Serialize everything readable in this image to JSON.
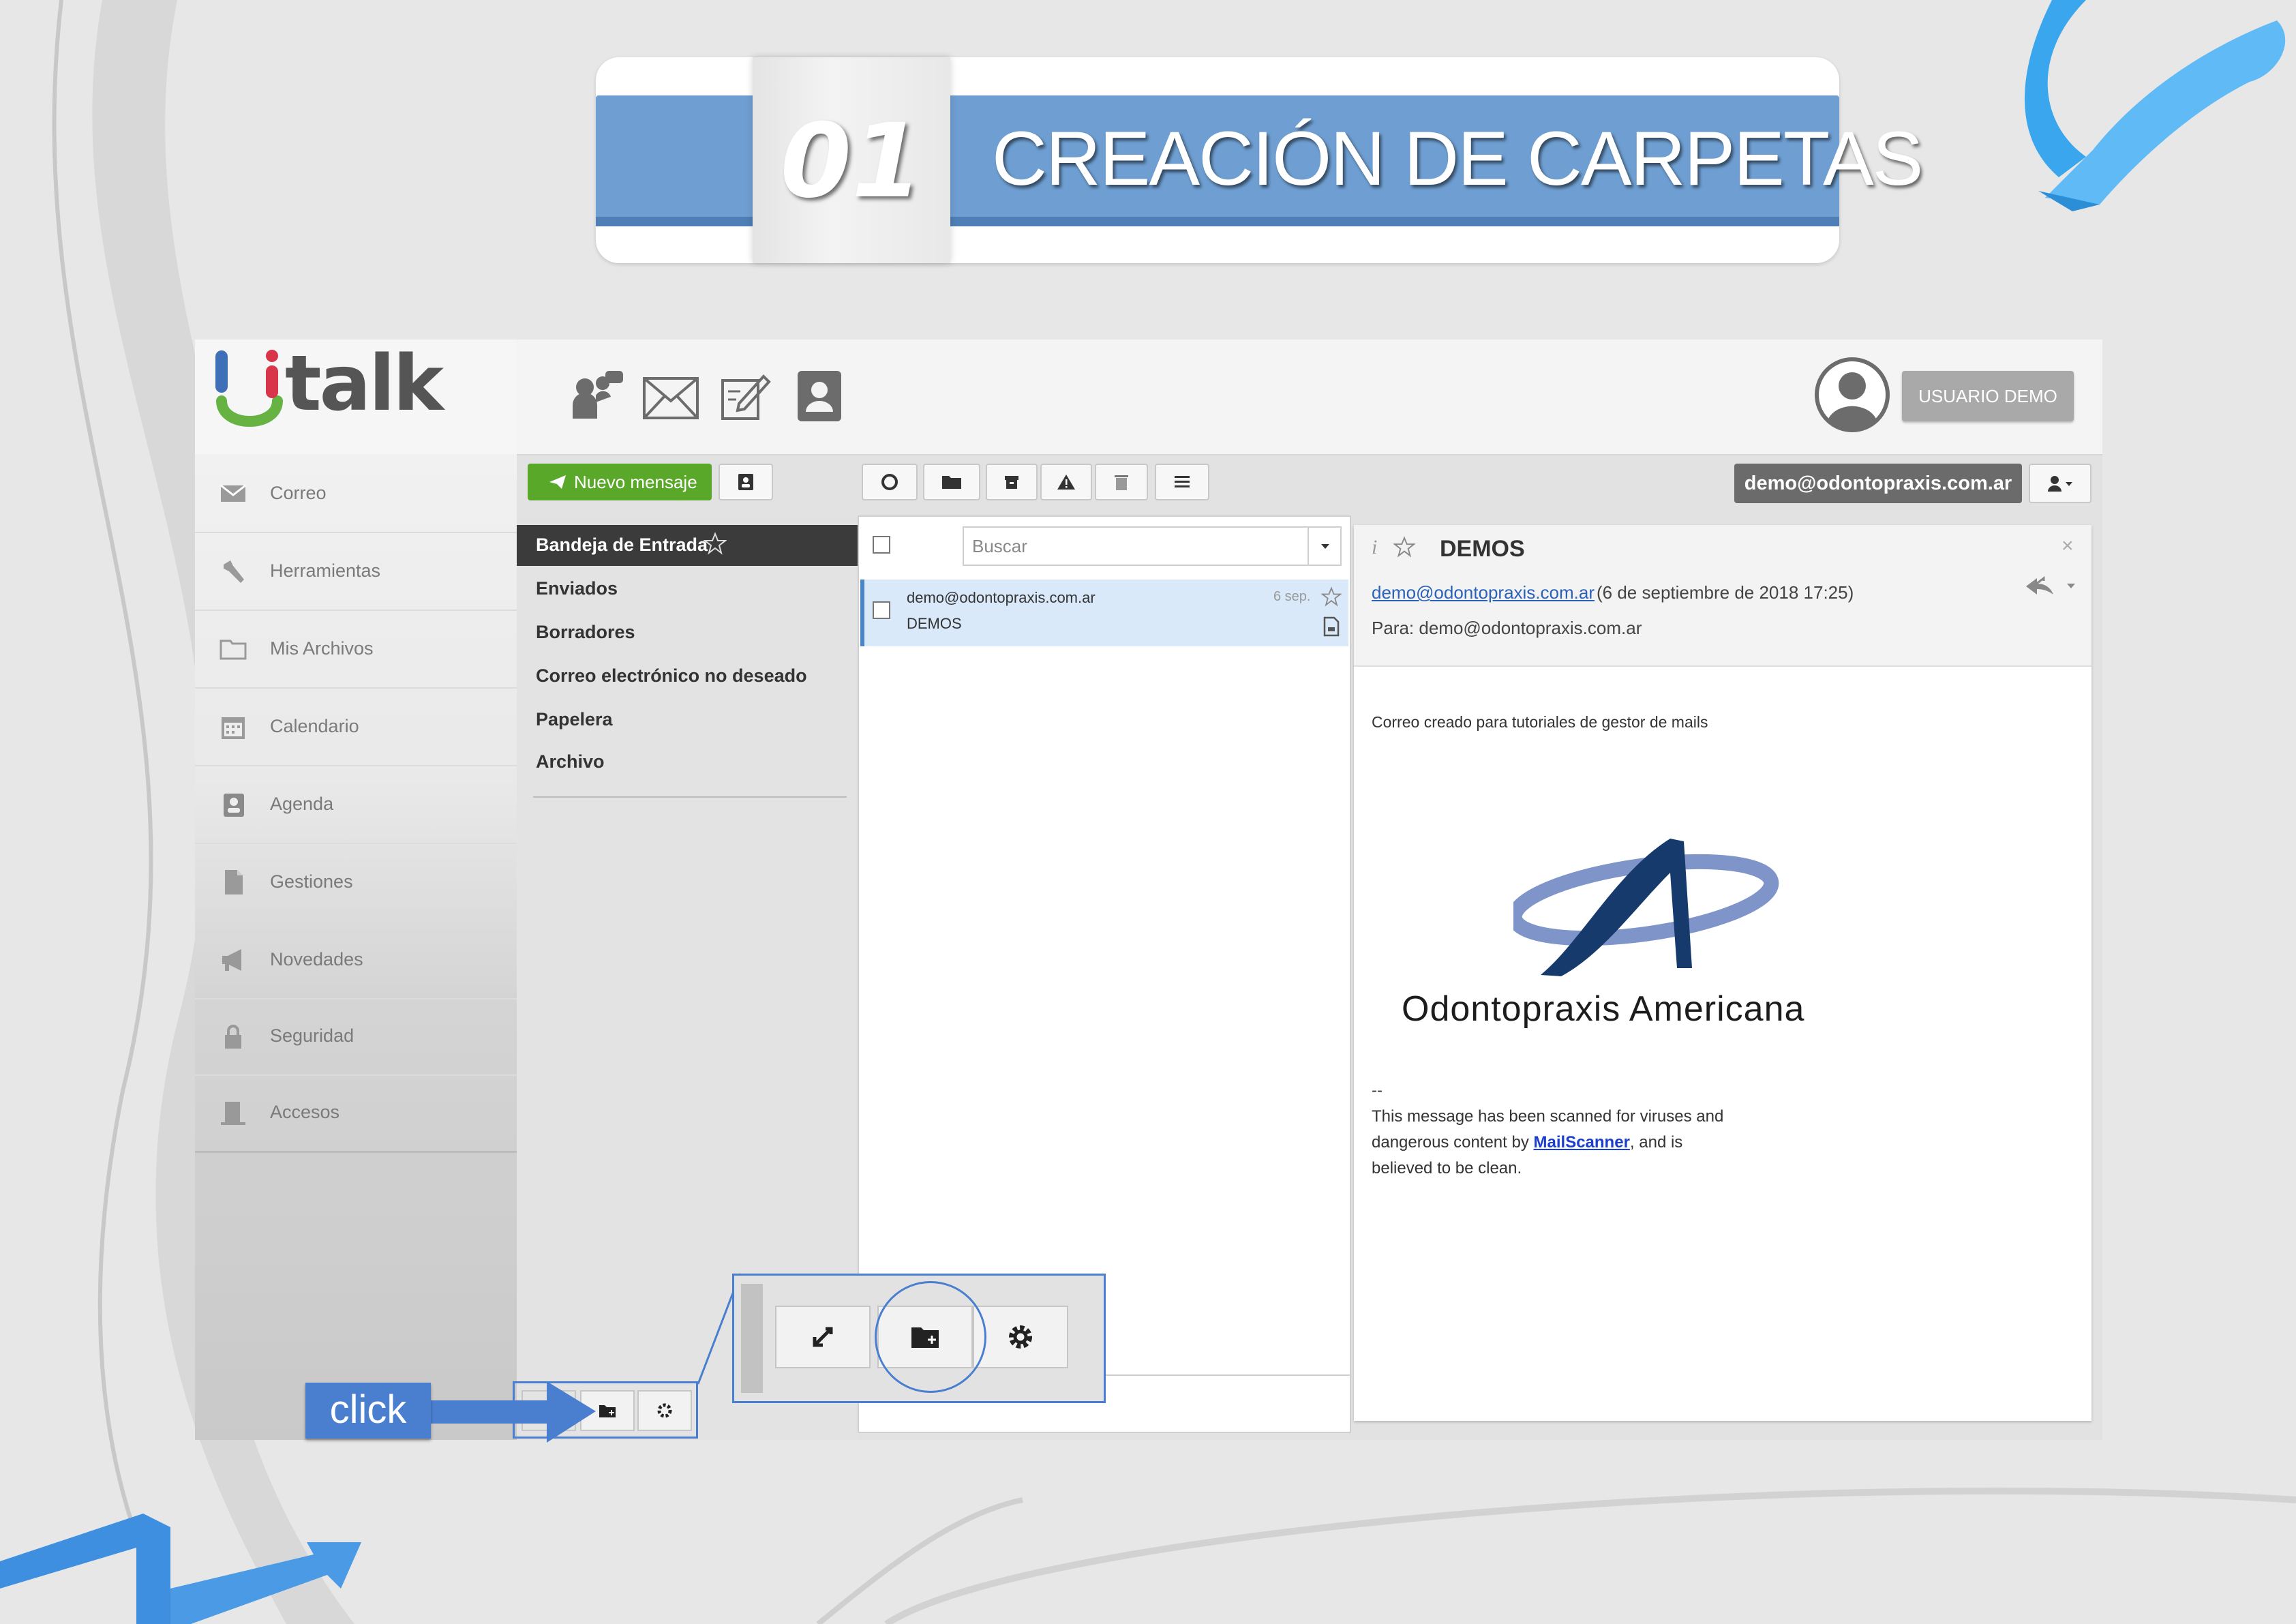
{
  "banner": {
    "number": "01",
    "title": "CREACIÓN DE CARPETAS"
  },
  "app": {
    "logo_text": "talk",
    "user_button": "USUARIO DEMO",
    "account_email": "demo@odontopraxis.com.ar",
    "new_message_label": "Nuevo mensaje"
  },
  "sidebar": {
    "items": [
      {
        "label": "Correo",
        "icon": "envelope-icon"
      },
      {
        "label": "Herramientas",
        "icon": "wrench-icon"
      },
      {
        "label": "Mis Archivos",
        "icon": "folder-icon"
      },
      {
        "label": "Calendario",
        "icon": "calendar-icon"
      },
      {
        "label": "Agenda",
        "icon": "contact-book-icon"
      },
      {
        "label": "Gestiones",
        "icon": "document-icon"
      },
      {
        "label": "Novedades",
        "icon": "megaphone-icon"
      },
      {
        "label": "Seguridad",
        "icon": "lock-icon"
      },
      {
        "label": "Accesos",
        "icon": "door-icon"
      }
    ]
  },
  "folders": [
    {
      "label": "Bandeja de Entrada"
    },
    {
      "label": "Enviados"
    },
    {
      "label": "Borradores"
    },
    {
      "label": "Correo electrónico no deseado"
    },
    {
      "label": "Papelera"
    },
    {
      "label": "Archivo"
    }
  ],
  "message_list": {
    "search_placeholder": "Buscar",
    "messages": [
      {
        "from": "demo@odontopraxis.com.ar",
        "subject": "DEMOS",
        "date": "6 sep."
      }
    ]
  },
  "reading": {
    "subject": "DEMOS",
    "from": "demo@odontopraxis.com.ar",
    "date": "(6 de septiembre de 2018 17:25)",
    "to": "Para: demo@odontopraxis.com.ar",
    "body_line": "Correo creado para tutoriales de gestor de mails",
    "logo_text": "Odontopraxis Americana",
    "sig_dash": "--",
    "sig_line1": "This message has been scanned for viruses and",
    "sig_line2a": "dangerous content by ",
    "sig_link": "MailScanner",
    "sig_line2b": ", and is",
    "sig_line3": "believed to be clean."
  },
  "callout": {
    "click_label": "click"
  },
  "colors": {
    "accent_blue": "#4a7fd0",
    "banner_blue": "#6f9fd2",
    "green": "#5aa82a"
  }
}
